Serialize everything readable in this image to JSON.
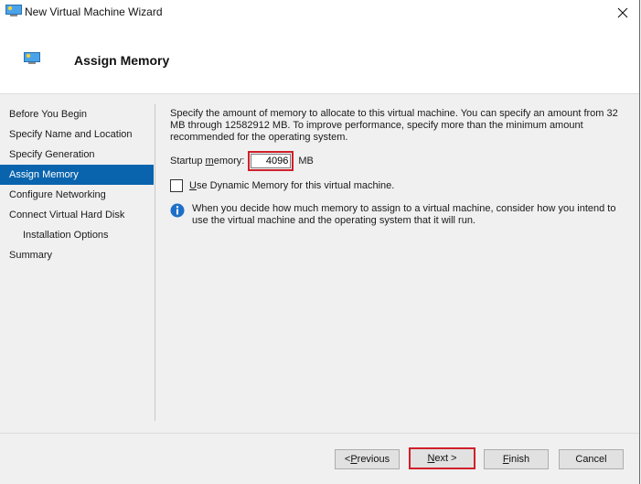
{
  "window": {
    "title": "New Virtual Machine Wizard",
    "title_icon": "hyper-v-vm-icon",
    "close_icon": "close-icon"
  },
  "header": {
    "title": "Assign Memory",
    "icon": "hyper-v-vm-icon"
  },
  "sidebar": {
    "steps": [
      {
        "label": "Before You Begin",
        "active": false,
        "indent": false
      },
      {
        "label": "Specify Name and Location",
        "active": false,
        "indent": false
      },
      {
        "label": "Specify Generation",
        "active": false,
        "indent": false
      },
      {
        "label": "Assign Memory",
        "active": true,
        "indent": false
      },
      {
        "label": "Configure Networking",
        "active": false,
        "indent": false
      },
      {
        "label": "Connect Virtual Hard Disk",
        "active": false,
        "indent": false
      },
      {
        "label": "Installation Options",
        "active": false,
        "indent": true
      },
      {
        "label": "Summary",
        "active": false,
        "indent": false
      }
    ]
  },
  "content": {
    "description": "Specify the amount of memory to allocate to this virtual machine. You can specify an amount from 32 MB through 12582912 MB. To improve performance, specify more than the minimum amount recommended for the operating system.",
    "startup_memory": {
      "label_pre": "Startup ",
      "label_accel": "m",
      "label_post": "emory:",
      "value": "4096",
      "unit": "MB"
    },
    "dynamic_memory": {
      "label_accel": "U",
      "label_post": "se Dynamic Memory for this virtual machine.",
      "checked": false
    },
    "info_text": "When you decide how much memory to assign to a virtual machine, consider how you intend to use the virtual machine and the operating system that it will run."
  },
  "buttons": {
    "previous": {
      "pre": "< ",
      "accel": "P",
      "post": "revious"
    },
    "next": {
      "pre": "",
      "accel": "N",
      "post": "ext >"
    },
    "finish": {
      "pre": "",
      "accel": "F",
      "post": "inish"
    },
    "cancel": {
      "label": "Cancel"
    }
  },
  "colors": {
    "active_step_bg": "#0a64ad",
    "highlight_border": "#d0202a",
    "info_icon": "#1e6fc8"
  }
}
